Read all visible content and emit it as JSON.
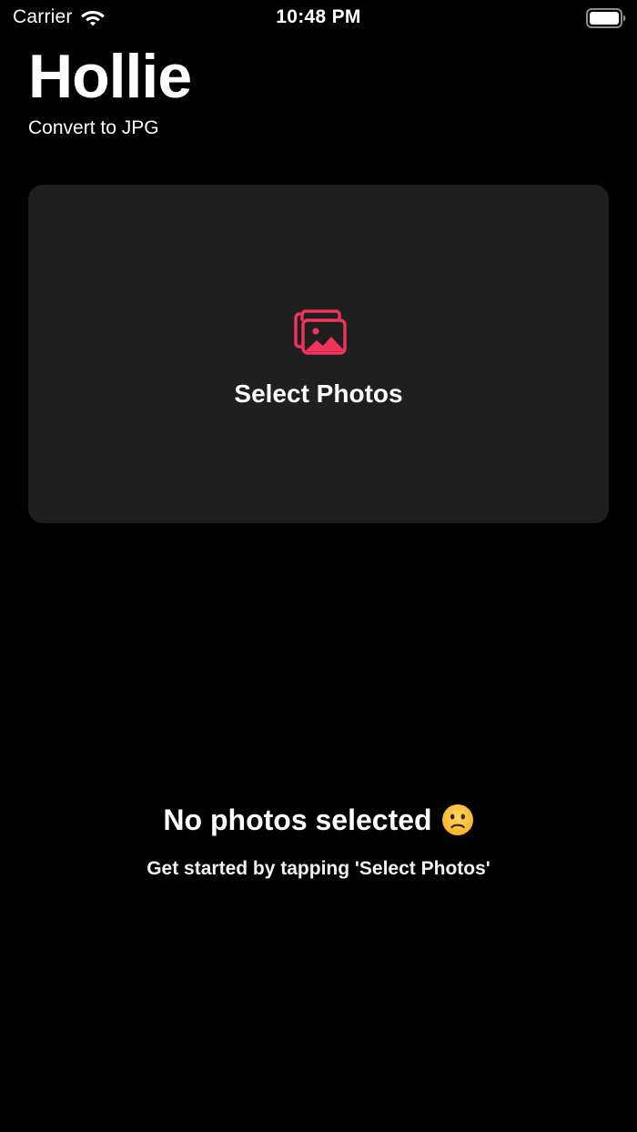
{
  "status_bar": {
    "carrier": "Carrier",
    "time": "10:48 PM",
    "wifi_icon": "wifi-icon",
    "battery_icon": "battery-full-icon"
  },
  "header": {
    "title": "Hollie",
    "subtitle": "Convert to JPG"
  },
  "select_card": {
    "icon": "photo-stack-icon",
    "label": "Select Photos"
  },
  "empty_state": {
    "title": "No photos selected",
    "icon": "sad-face-emoji-icon",
    "subtitle": "Get started by tapping 'Select Photos'"
  },
  "colors": {
    "background": "#000000",
    "card": "#1f1f1f",
    "accent": "#f0345c",
    "text": "#ffffff"
  }
}
